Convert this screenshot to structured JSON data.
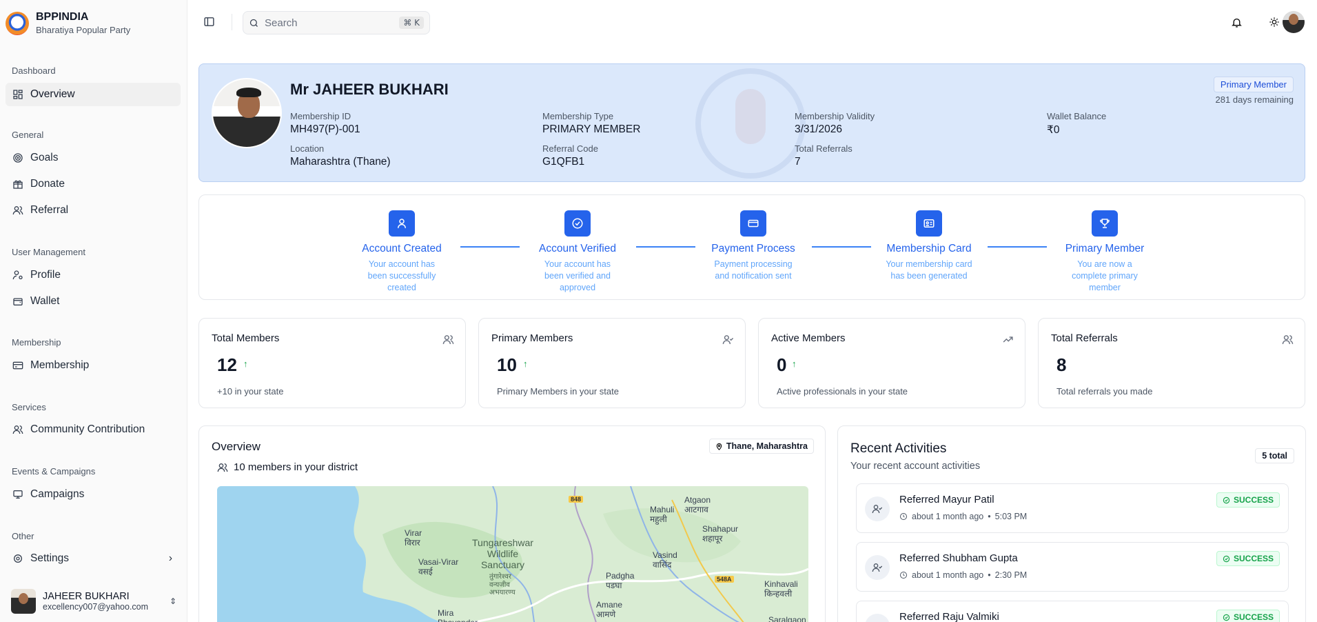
{
  "brand": {
    "name": "BPPINDIA",
    "subtitle": "Bharatiya Popular Party"
  },
  "sidebar": {
    "groups": {
      "dashboard": "Dashboard",
      "general": "General",
      "user_management": "User Management",
      "membership": "Membership",
      "services": "Services",
      "events": "Events & Campaigns",
      "other": "Other"
    },
    "items": {
      "overview": "Overview",
      "goals": "Goals",
      "donate": "Donate",
      "referral": "Referral",
      "profile": "Profile",
      "wallet": "Wallet",
      "membership": "Membership",
      "community": "Community Contribution",
      "campaigns": "Campaigns",
      "settings": "Settings"
    },
    "user": {
      "name": "JAHEER BUKHARI",
      "email": "excellency007@yahoo.com"
    }
  },
  "topbar": {
    "search_placeholder": "Search",
    "shortcut": "⌘ K"
  },
  "profile": {
    "name": "Mr JAHEER BUKHARI",
    "badge": "Primary Member",
    "days_remaining": "281 days remaining",
    "fields": {
      "membership_id": {
        "label": "Membership ID",
        "value": "MH497(P)-001"
      },
      "membership_type": {
        "label": "Membership Type",
        "value": "PRIMARY MEMBER"
      },
      "validity": {
        "label": "Membership Validity",
        "value": "3/31/2026"
      },
      "wallet": {
        "label": "Wallet Balance",
        "value": "₹0"
      },
      "location": {
        "label": "Location",
        "value": "Maharashtra (Thane)"
      },
      "referral_code": {
        "label": "Referral Code",
        "value": "G1QFB1"
      },
      "total_referrals": {
        "label": "Total Referrals",
        "value": "7"
      }
    }
  },
  "steps": [
    {
      "title": "Account Created",
      "desc": "Your account has been successfully created"
    },
    {
      "title": "Account Verified",
      "desc": "Your account has been verified and approved"
    },
    {
      "title": "Payment Process",
      "desc": "Payment processing and notification sent"
    },
    {
      "title": "Membership Card",
      "desc": "Your membership card has been generated"
    },
    {
      "title": "Primary Member",
      "desc": "You are now a complete primary member"
    }
  ],
  "stats": [
    {
      "title": "Total Members",
      "value": "12",
      "arrow": "↑",
      "note": "+10 in your state"
    },
    {
      "title": "Primary Members",
      "value": "10",
      "arrow": "↑",
      "note": "Primary Members in your state"
    },
    {
      "title": "Active Members",
      "value": "0",
      "arrow": "↑",
      "note": "Active professionals in your state"
    },
    {
      "title": "Total Referrals",
      "value": "8",
      "arrow": "",
      "note": "Total referrals you made"
    }
  ],
  "overview": {
    "title": "Overview",
    "location": "Thane, Maharashtra",
    "members_text": "10 members in your district",
    "map": {
      "labels": {
        "virar": "Virar\nविरार",
        "sanctuary": "Tungareshwar\nWildlife\nSanctuary",
        "sanctuary_local": "तुंगारेश्वर\nवन्यजीव\nअभयारण्य",
        "vasai": "Vasai-Virar\nवसई",
        "mahuli": "Mahuli\nमहुली",
        "atgaon": "Atgaon\nआटगाव",
        "shahapur": "Shahapur\nशहापूर",
        "vasind": "Vasind\nवासिंद",
        "padgha": "Padgha\nपडघा",
        "kinhavali": "Kinhavali\nकिन्हवली",
        "amane": "Amane\nआमणे",
        "mira": "Mira\nBhayander",
        "saralgaon": "Saralgaon"
      },
      "roads": {
        "r1": "848",
        "r2": "548A"
      }
    }
  },
  "activities": {
    "title": "Recent Activities",
    "subtitle": "Your recent account activities",
    "total": "5 total",
    "items": [
      {
        "name": "Referred Mayur Patil",
        "when": "about 1 month ago",
        "sep": "•",
        "time": "5:03 PM",
        "status": "SUCCESS"
      },
      {
        "name": "Referred Shubham Gupta",
        "when": "about 1 month ago",
        "sep": "•",
        "time": "2:30 PM",
        "status": "SUCCESS"
      },
      {
        "name": "Referred Raju Valmiki",
        "when": "",
        "sep": "",
        "time": "",
        "status": "SUCCESS"
      }
    ]
  },
  "colors": {
    "accent": "#2563eb",
    "profile_bg": "#dbe8fb",
    "success": "#16a34a"
  }
}
